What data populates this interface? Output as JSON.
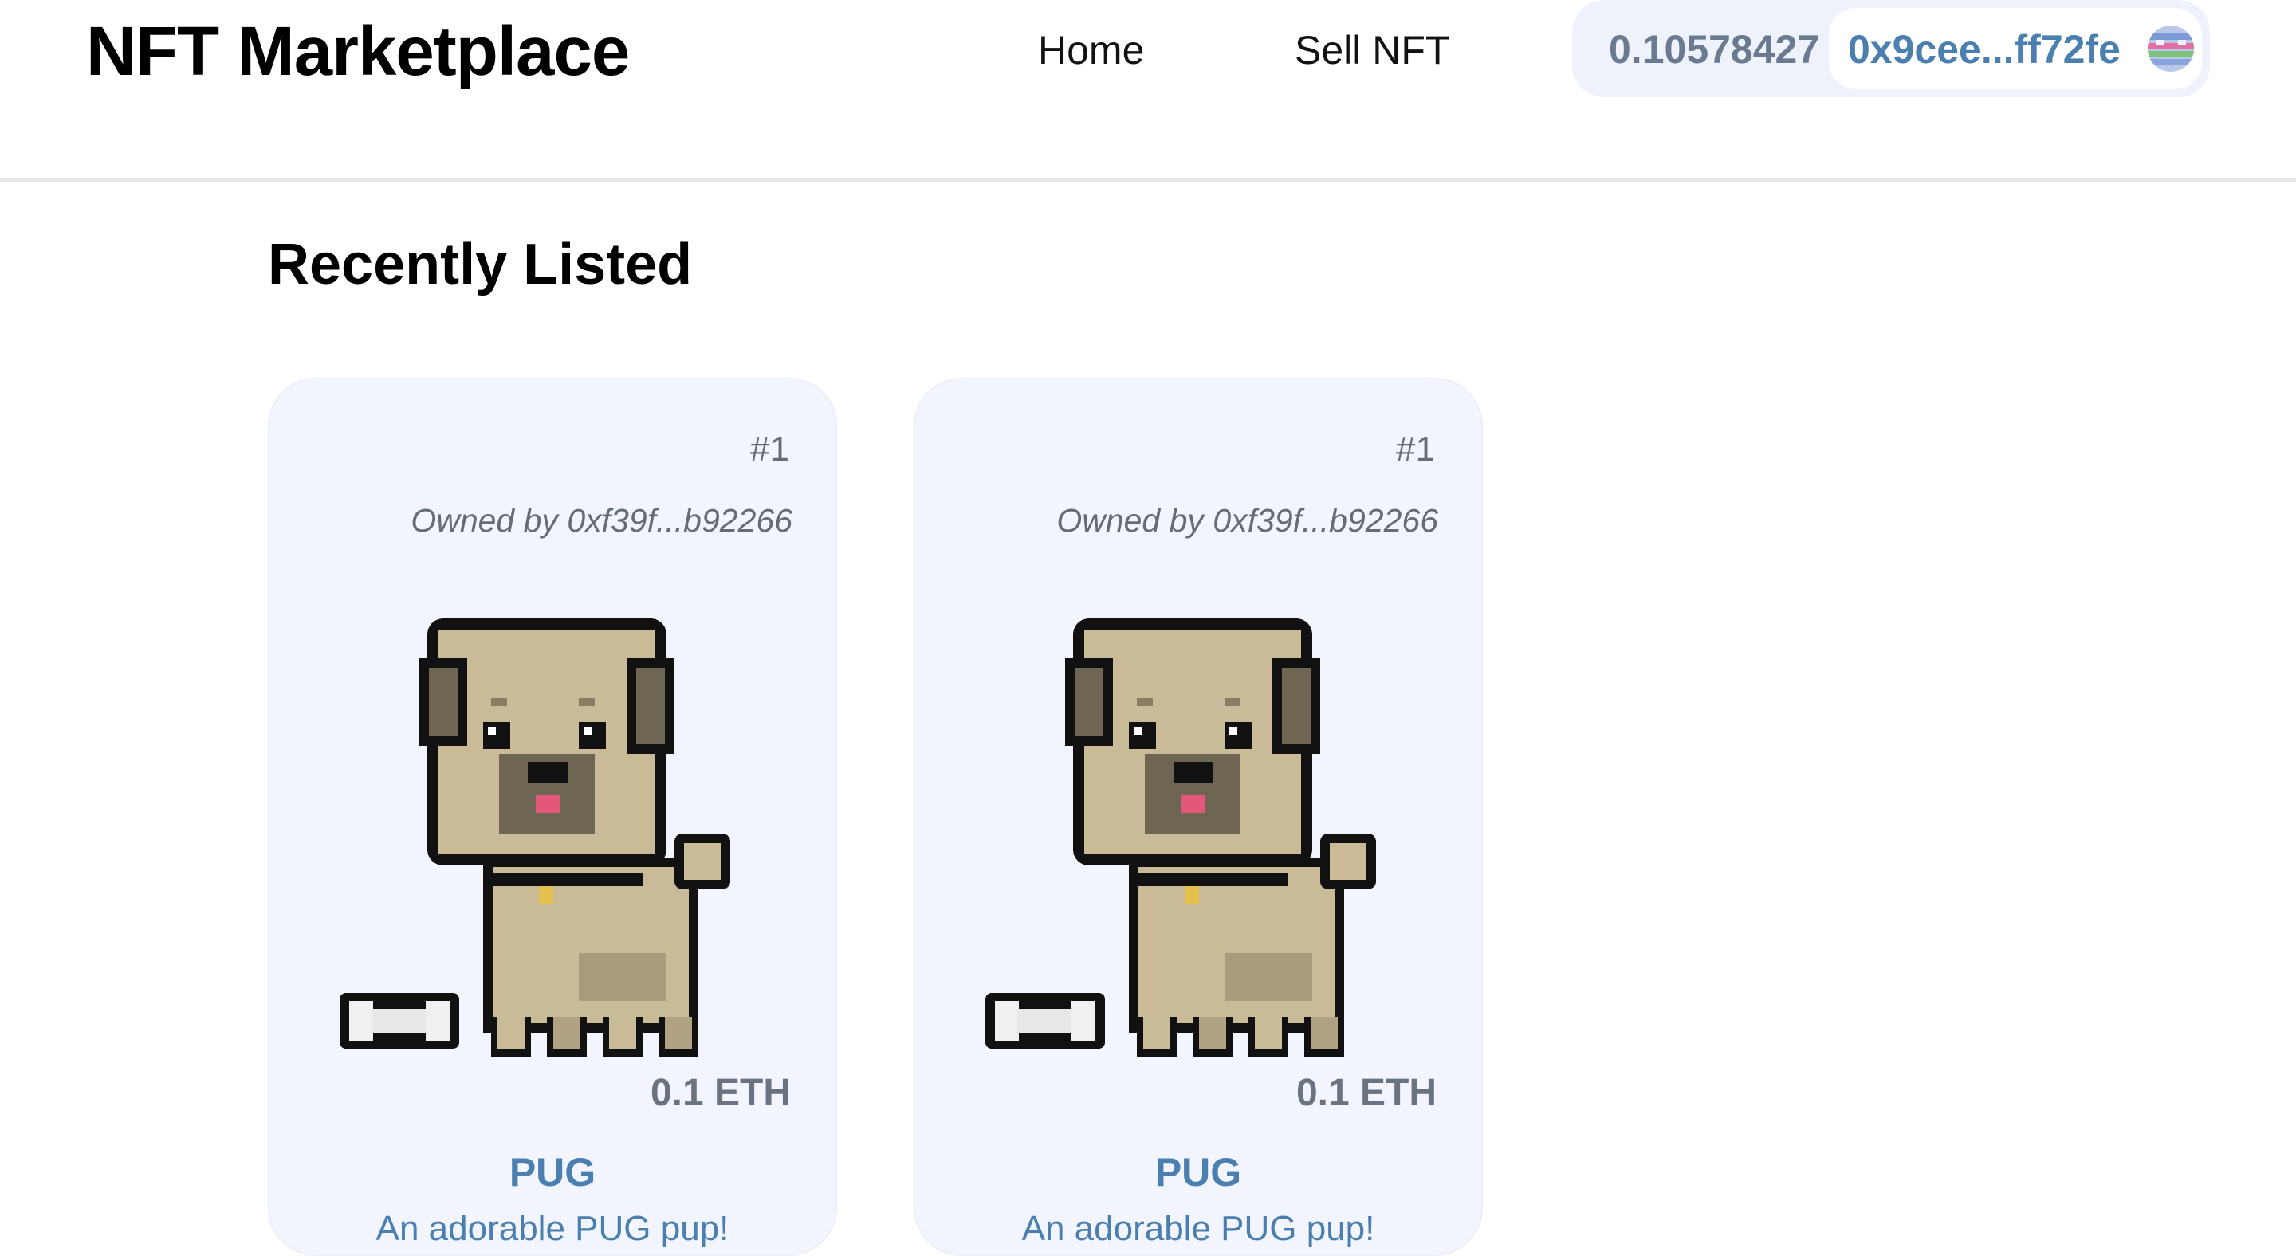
{
  "header": {
    "brand": "NFT Marketplace",
    "nav": [
      {
        "label": "Home"
      },
      {
        "label": "Sell NFT"
      }
    ],
    "wallet": {
      "balance": "0.10578427",
      "address": "0x9cee...ff72fe",
      "avatar_icon": "avatar-icon"
    }
  },
  "main": {
    "section_title": "Recently Listed",
    "cards": [
      {
        "token_id": "#1",
        "owner": "Owned by 0xf39f...b92266",
        "image_icon": "pixel-pug-image",
        "price": "0.1 ETH",
        "name": "PUG",
        "description": "An adorable PUG pup!"
      },
      {
        "token_id": "#1",
        "owner": "Owned by 0xf39f...b92266",
        "image_icon": "pixel-pug-image",
        "price": "0.1 ETH",
        "name": "PUG",
        "description": "An adorable PUG pup!"
      }
    ]
  },
  "colors": {
    "accent_blue": "#4a7fb0",
    "card_bg": "#f2f5fd",
    "wallet_bg": "#eef2fb",
    "muted_gray": "#6b7280"
  }
}
